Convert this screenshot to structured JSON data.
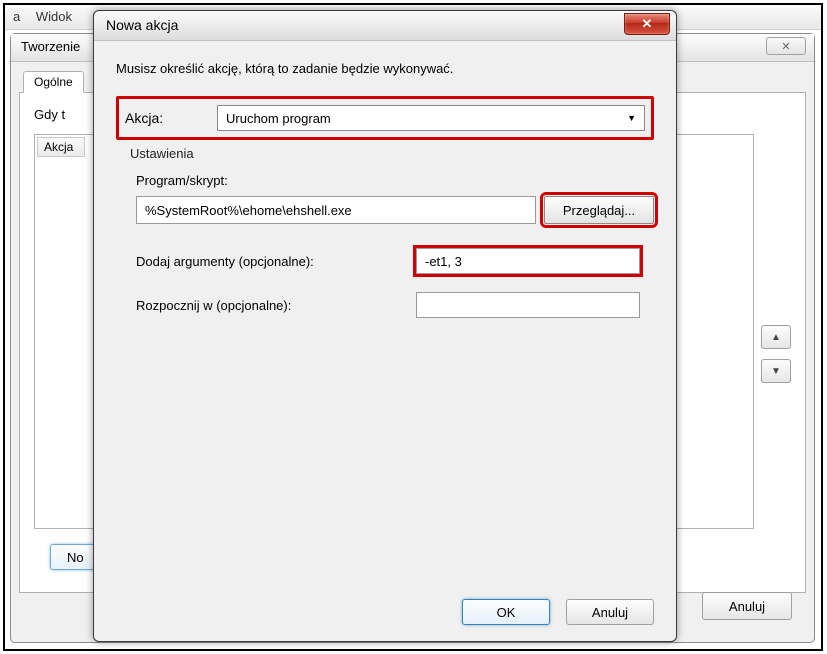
{
  "menubar": {
    "item1": "a",
    "item2": "Widok"
  },
  "bg": {
    "title": "Tworzenie",
    "tab": "Ogólne",
    "label": "Gdy t",
    "list_col": "Akcja",
    "bottom_btn": "No",
    "cancel": "Anuluj"
  },
  "dlg": {
    "title": "Nowa akcja",
    "intro": "Musisz określić akcję, którą to zadanie będzie wykonywać.",
    "action_label": "Akcja:",
    "action_value": "Uruchom program",
    "group": "Ustawienia",
    "program_label": "Program/skrypt:",
    "program_value": "%SystemRoot%\\ehome\\ehshell.exe",
    "browse": "Przeglądaj...",
    "args_label": "Dodaj argumenty (opcjonalne):",
    "args_value": "-et1, 3",
    "startin_label": "Rozpocznij w (opcjonalne):",
    "startin_value": "",
    "ok": "OK",
    "cancel": "Anuluj"
  }
}
